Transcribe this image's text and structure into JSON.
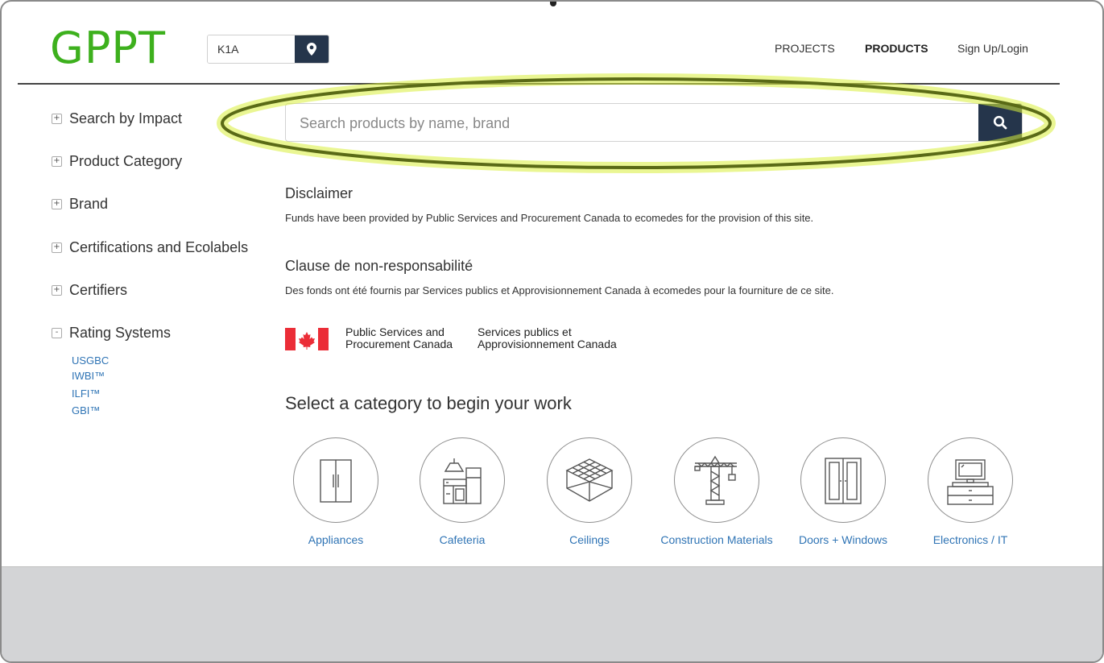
{
  "header": {
    "logo": "GPPT",
    "zip_value": "K1A",
    "nav": {
      "projects": "PROJECTS",
      "products": "PRODUCTS",
      "signup": "Sign Up/Login"
    }
  },
  "sidebar": {
    "items": [
      {
        "label": "Search by Impact",
        "toggle": "+"
      },
      {
        "label": "Product Category",
        "toggle": "+"
      },
      {
        "label": "Brand",
        "toggle": "+"
      },
      {
        "label": "Certifications and Ecolabels",
        "toggle": "+"
      },
      {
        "label": "Certifiers",
        "toggle": "+"
      },
      {
        "label": "Rating Systems",
        "toggle": "-"
      }
    ],
    "rating_systems": [
      "USGBC",
      "IWBI™",
      "ILFI™",
      "GBI™"
    ]
  },
  "search": {
    "placeholder": "Search products by name, brand",
    "value": ""
  },
  "disclaimer": {
    "title_en": "Disclaimer",
    "text_en": "Funds have been provided by Public Services and Procurement Canada to ecomedes for the provision of this site.",
    "title_fr": "Clause de non-responsabilité",
    "text_fr": "Des fonds ont été fournis par Services publics et Approvisionnement Canada à ecomedes pour la fourniture de ce site."
  },
  "gov_signature": {
    "en_line1": "Public Services and",
    "en_line2": "Procurement Canada",
    "fr_line1": "Services publics et",
    "fr_line2": "Approvisionnement Canada"
  },
  "categories": {
    "title": "Select a category to begin your work",
    "items": [
      {
        "label": "Appliances",
        "icon": "refrigerator-icon"
      },
      {
        "label": "Cafeteria",
        "icon": "kitchen-icon"
      },
      {
        "label": "Ceilings",
        "icon": "ceiling-grid-icon"
      },
      {
        "label": "Construction Materials",
        "icon": "crane-icon"
      },
      {
        "label": "Doors + Windows",
        "icon": "double-door-icon"
      },
      {
        "label": "Electronics / IT",
        "icon": "computer-desk-icon"
      }
    ]
  },
  "colors": {
    "logo": "#3db01d",
    "button": "#25354b",
    "link": "#2f74b5",
    "highlight": "#d9ef3a"
  }
}
